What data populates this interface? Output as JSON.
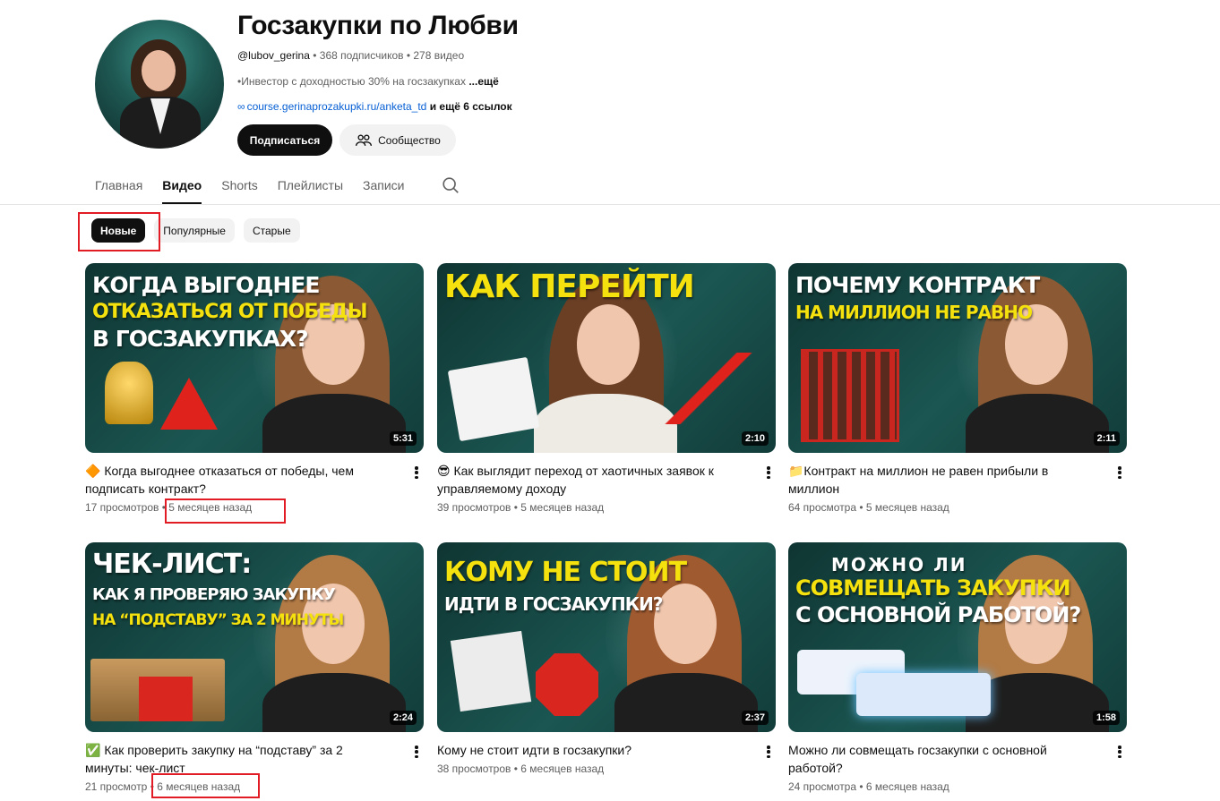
{
  "channel": {
    "title": "Госзакупки по Любви",
    "handle": "@lubov_gerina",
    "meta_rest": " • 368 подписчиков • 278 видео",
    "description": "•Инвестор с доходностью 30% на госзакупках ",
    "description_more": "...ещё",
    "link_url": "course.gerinaprozakupki.ru/anketa_td",
    "link_extra": " и ещё 6 ссылок",
    "subscribe_label": "Подписаться",
    "community_label": "Сообщество"
  },
  "tabs": [
    "Главная",
    "Видео",
    "Shorts",
    "Плейлисты",
    "Записи"
  ],
  "active_tab": "Видео",
  "chips": [
    "Новые",
    "Популярные",
    "Старые"
  ],
  "active_chip": "Новые",
  "colors": {
    "highlight": "#e11c24",
    "accent_yellow": "#f5e10d",
    "link": "#065fd4"
  },
  "videos": [
    {
      "title": "🔶 Когда выгоднее отказаться от победы, чем подписать контракт?",
      "views": "17 просмотров",
      "age": " • 5 месяцев назад",
      "duration": "5:31",
      "thumb": {
        "line1": "Когда выгоднее",
        "line2": "отказаться от победы",
        "line3": "в госзакупках?"
      }
    },
    {
      "title": "😎 Как выглядит переход от хаотичных заявок к управляемому доходу",
      "views": "39 просмотров",
      "age": " • 5 месяцев назад",
      "duration": "2:10",
      "thumb": {
        "line1": "",
        "line2": "Как перейти",
        "line3": ""
      }
    },
    {
      "title": "📁Контракт на миллион не равен прибыли в миллион",
      "views": "64 просмотра",
      "age": " • 5 месяцев назад",
      "duration": "2:11",
      "thumb": {
        "line1": "Почему контракт",
        "line2": "на миллион не равно",
        "line3": ""
      }
    },
    {
      "title": "✅ Как проверить закупку на “подставу” за 2 минуты: чек-лист",
      "views": "21 просмотр",
      "age": " • 6 месяцев назад",
      "duration": "2:24",
      "thumb": {
        "line1": "Чек-лист:",
        "line2": "Как я проверяю закупку",
        "line3": "на “подставу” за 2 минуты"
      }
    },
    {
      "title": "Кому не стоит идти в госзакупки?",
      "views": "38 просмотров",
      "age": " • 6 месяцев назад",
      "duration": "2:37",
      "thumb": {
        "line1": "",
        "line2": "Кому не стоит",
        "line3": "идти в госзакупки?"
      }
    },
    {
      "title": "Можно ли совмещать госзакупки с основной работой?",
      "views": "24 просмотра",
      "age": " • 6 месяцев назад",
      "duration": "1:58",
      "thumb": {
        "line1": "Можно ли",
        "line2": "совмещать закупки",
        "line3": "с основной работой?"
      }
    }
  ]
}
